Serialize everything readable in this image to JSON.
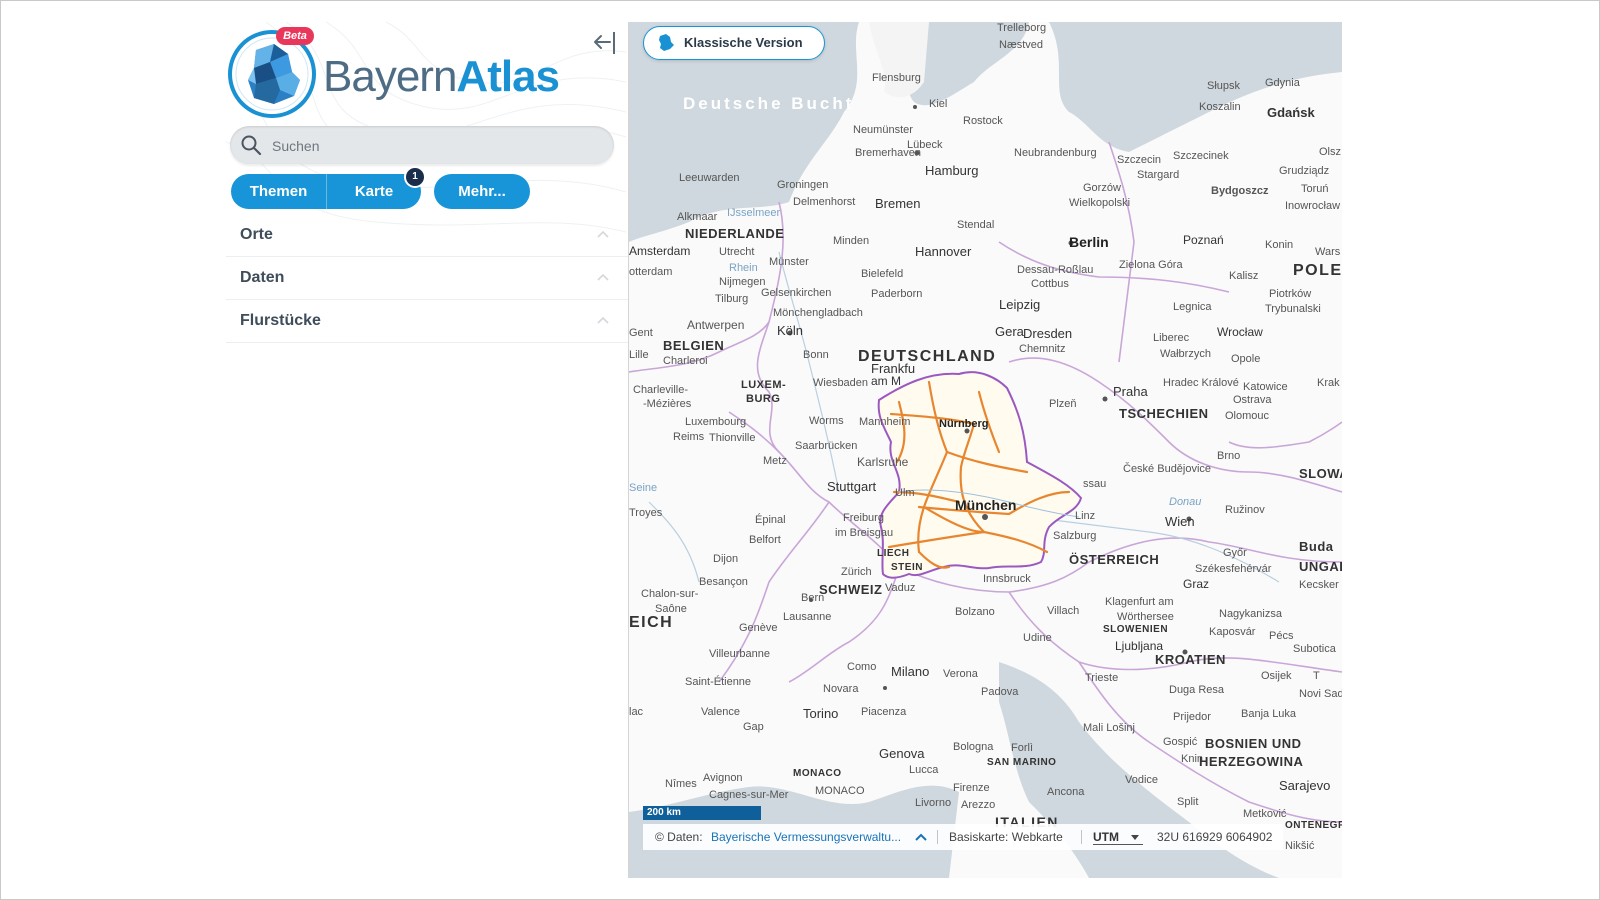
{
  "app": {
    "logo_bayern": "Bayern",
    "logo_atlas": "Atlas",
    "beta": "Beta",
    "collapse_icon": "arrow-left-bar-icon"
  },
  "search": {
    "placeholder": "Suchen",
    "value": ""
  },
  "tabs": {
    "themen": "Themen",
    "karte": "Karte",
    "karte_badge": "1",
    "mehr": "Mehr..."
  },
  "accordion": [
    {
      "label": "Orte"
    },
    {
      "label": "Daten"
    },
    {
      "label": "Flurstücke"
    }
  ],
  "map": {
    "classic_button": "Klassische Version",
    "scale": "200 km",
    "attribution_prefix": "© Daten:",
    "attribution_link": "Bayerische Vermessungsverwaltu...",
    "basemap": "Basiskarte: Webkarte",
    "projection": "UTM",
    "coords": "32U 616929 6064902",
    "labels": {
      "deutschland": "DEUTSCHLAND",
      "niederlande": "NIEDERLANDE",
      "belgien": "BELGIEN",
      "luxemburg1": "LUXEM-",
      "luxemburg2": "BURG",
      "schweiz": "SCHWEIZ",
      "oesterreich": "ÖSTERREICH",
      "tschechien": "TSCHECHIEN",
      "pole": "POLE",
      "eich": "EICH",
      "slowenien": "SLOWENIEN",
      "kroatien": "KROATIEN",
      "bosnien1": "BOSNIEN UND",
      "bosnien2": "HERZEGOWINA",
      "liech1": "LIECH",
      "liech2": "STEIN",
      "monaco": "MONACO",
      "san_marino": "SAN MARINO",
      "slowa": "SLOWA",
      "ungar": "UNGAR",
      "italien": "ITALIEN",
      "montenegro": "ONTENEGR",
      "sea": "Deutsche Bucht",
      "muenchen": "München",
      "nuernberg": "Nürnberg",
      "berlin": "Berlin",
      "hamburg": "Hamburg",
      "bremen": "Bremen",
      "hannover": "Hannover",
      "leipzig": "Leipzig",
      "dresden": "Dresden",
      "koeln": "Köln",
      "frankfurt1": "Frankfu",
      "frankfurt2": "am M",
      "stuttgart": "Stuttgart",
      "karlsruhe": "Karlsruhe",
      "praha": "Praha",
      "wien": "Wien",
      "zuerich": "Zürich",
      "milano": "Milano",
      "torino": "Torino",
      "genova": "Genova",
      "amsterdam": "Amsterdam",
      "bydgoszcz": "Bydgoszcz",
      "szczecin": "Szczecin",
      "poznan": "Poznań",
      "wroclaw": "Wrocław",
      "gdansk": "Gdańsk",
      "graz": "Graz",
      "linz": "Linz",
      "salzburg": "Salzburg",
      "innsbruck": "Innsbruck",
      "ljubljana": "Ljubljana",
      "bolzano": "Bolzano",
      "bologna": "Bologna",
      "venezia": "Verona",
      "firenze": "Firenze",
      "lyon": "Villeurbanne",
      "dijon": "Dijon",
      "bern": "Bern",
      "lausanne": "Lausanne",
      "geneve": "Genève",
      "besancon": "Besançon",
      "metz": "Metz",
      "reims": "Reims",
      "trier": "Saarbrücken",
      "mannheim": "Mannheim",
      "wiesbaden": "Wiesbaden",
      "bonn": "Bonn",
      "muenster": "Münster",
      "bielefeld": "Bielefeld",
      "kiel": "Kiel",
      "rostock": "Rostock",
      "luebeck": "Lübeck",
      "flensburg": "Flensburg",
      "magdeburg": "Stendal",
      "chemnitz": "Chemnitz",
      "plzen": "Plzeň",
      "brno": "Brno",
      "ulm": "Ulm",
      "freiburg1": "Freiburg",
      "freiburg2": "im Breisgau",
      "antwerpen": "Antwerpen",
      "charleroi": "Charleroi",
      "luxembourg": "Luxembourg",
      "utrecht": "Utrecht",
      "rotterdam": "otterdam",
      "groningen": "Groningen",
      "leeuwarden": "Leeuwarden",
      "koszalin": "Koszalin",
      "slupsk": "Słupsk",
      "gdynia": "Gdynia",
      "ostrava": "Ostrava",
      "katowice": "Katowice",
      "olomouc": "Olomouc",
      "zagreb": "Kaposvár",
      "split": "Split",
      "sarajevo": "Sarajevo",
      "trieste": "Trieste",
      "udine": "Udine",
      "padova": "Padova",
      "como": "Como",
      "novara": "Novara",
      "piacenza": "Piacenza",
      "lucca": "Lucca",
      "livorno": "Livorno",
      "arezzo": "Arezzo",
      "ancona": "Ancona",
      "forli": "Forlì",
      "avignon": "Avignon",
      "nimes": "Nîmes",
      "cagnes": "Cagnes-sur-Mer",
      "valence": "Valence",
      "gap": "Gap",
      "grenoble": "Saint-Étienne",
      "chalon1": "Chalon-sur-",
      "chalon2": "Saône",
      "troyes": "Troyes",
      "epinal": "Épinal",
      "belfort": "Belfort",
      "vaduz": "Vaduz",
      "villach": "Villach",
      "klagenfurt": "Klagenfurt am",
      "worthersee": "Wörthersee",
      "ceske": "České Budějovice",
      "pecs": "Pécs",
      "gyor": "Győr",
      "szekes": "Székesfehérvár",
      "osijek": "Osijek",
      "novisad": "Novi Sad",
      "ruzinov": "Ružinov",
      "bratislava": "Buda",
      "krakow": "Krak",
      "opole": "Opole",
      "legnica": "Legnica",
      "zielona": "Zielona Góra",
      "cottbus": "Cottbus",
      "dessau": "Dessau-Roßlau",
      "gera": "Gera",
      "minden": "Minden",
      "paderborn": "Paderborn",
      "moenchengladbach": "Mönchengladbach",
      "gelsenkirchen": "Gelsenkirchen",
      "nijmegen": "Nijmegen",
      "tilburg": "Tilburg",
      "worms": "Worms",
      "delmenhorst": "Delmenhorst",
      "bremerhaven": "Bremerhaven",
      "neumuenster": "Neumünster",
      "neubrandenburg": "Neubrandenburg",
      "stargard": "Stargard",
      "szczecinek": "Szczecinek",
      "gorzow1": "Gorzów",
      "gorzow2": "Wielkopolski",
      "torun": "Toruń",
      "inowroclaw": "Inowrocław",
      "grudziadz": "Grudziądz",
      "konin": "Konin",
      "kalisz": "Kalisz",
      "piotrkow1": "Piotrków",
      "piotrkow2": "Trybunalski",
      "walbrzych": "Wałbrzych",
      "liberec": "Liberec",
      "hradec": "Hradec Králové",
      "dubrovnik": "Knin",
      "gospic": "Gospić",
      "mali": "Mali Lošinj",
      "duga": "Duga Resa",
      "prijedor": "Prijedor",
      "banja": "Banja Luka",
      "metkovic": "Metković",
      "vodice": "Vodice",
      "nagykanizsa": "Nagykanizsa",
      "subotica": "Subotica",
      "kecsker": "Kecsker",
      "niksic": "Nikšić",
      "trelleborg": "Trelleborg",
      "naestved": "Næstved",
      "alkmaar": "Alkmaar",
      "ijsselmeer": "IJsselmeer",
      "lille": "Lille",
      "gent": "Gent",
      "thionville": "Thionville",
      "charleville1": "Charleville-",
      "charleville2": "-Mézières",
      "wars": "Wars",
      "olsz": "Olsz",
      "rhein": "Rhein",
      "seine": "Seine",
      "donau": "Donau",
      "saone": "Saône"
    }
  },
  "colors": {
    "accent": "#1795d8",
    "badge": "#e8375a",
    "bavaria_border": "#9b59c0",
    "roads": "#e8862f"
  }
}
